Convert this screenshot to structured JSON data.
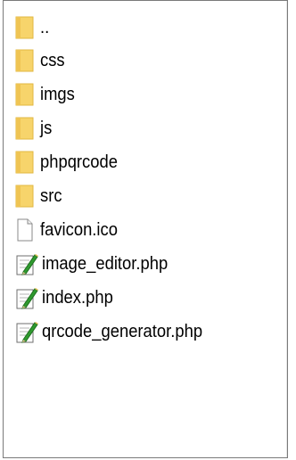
{
  "file_list": {
    "items": [
      {
        "label": "..",
        "icon": "folder-icon"
      },
      {
        "label": "css",
        "icon": "folder-icon"
      },
      {
        "label": "imgs",
        "icon": "folder-icon"
      },
      {
        "label": "js",
        "icon": "folder-icon"
      },
      {
        "label": "phpqrcode",
        "icon": "folder-icon"
      },
      {
        "label": "src",
        "icon": "folder-icon"
      },
      {
        "label": "favicon.ico",
        "icon": "document-icon"
      },
      {
        "label": "image_editor.php",
        "icon": "edit-document-icon"
      },
      {
        "label": "index.php",
        "icon": "edit-document-icon"
      },
      {
        "label": "qrcode_generator.php",
        "icon": "edit-document-icon"
      }
    ]
  },
  "colors": {
    "folder_fill": "#f7d46b",
    "folder_edge": "#e2b742",
    "panel_border": "#7a7a7a",
    "pencil": "#2f9a2f"
  }
}
